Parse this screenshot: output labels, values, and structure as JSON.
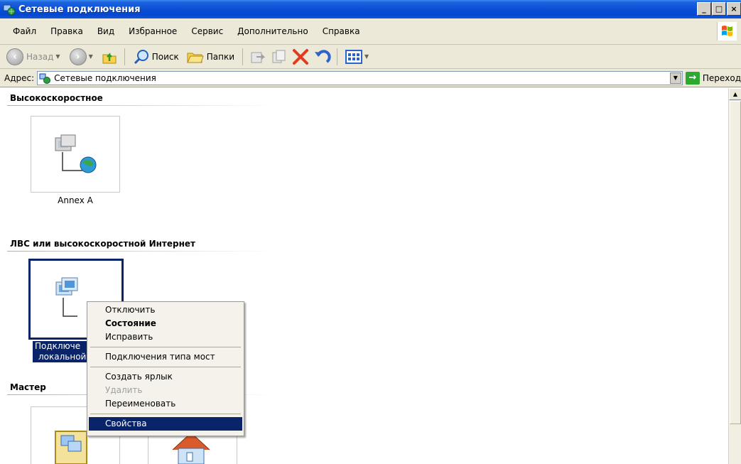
{
  "window": {
    "title": "Сетевые подключения",
    "controls": {
      "minimize": "_",
      "maximize": "□",
      "close": "×"
    }
  },
  "menu": [
    "Файл",
    "Правка",
    "Вид",
    "Избранное",
    "Сервис",
    "Дополнительно",
    "Справка"
  ],
  "toolbar": {
    "back_label": "Назад",
    "search_label": "Поиск",
    "folders_label": "Папки"
  },
  "address": {
    "label": "Адрес:",
    "value": "Сетевые подключения",
    "go_label": "Переход"
  },
  "groups": [
    {
      "header": "Высокоскоростное",
      "items": [
        {
          "label": "Annex A"
        }
      ]
    },
    {
      "header": "ЛВС или высокоскоростной Интернет",
      "items": [
        {
          "label_line1": "Подключе",
          "label_line2": "локальной"
        }
      ]
    },
    {
      "header": "Мастер",
      "items": []
    }
  ],
  "context_menu": {
    "items": [
      {
        "label": "Отключить",
        "style": "normal"
      },
      {
        "label": "Состояние",
        "style": "bold"
      },
      {
        "label": "Исправить",
        "style": "normal"
      },
      {
        "label": "Подключения типа мост",
        "style": "normal"
      },
      {
        "label": "Создать ярлык",
        "style": "normal"
      },
      {
        "label": "Удалить",
        "style": "disabled"
      },
      {
        "label": "Переименовать",
        "style": "normal"
      },
      {
        "label": "Свойства",
        "style": "highlighted"
      }
    ]
  },
  "colors": {
    "titlebar": "#0a4fd6",
    "selection": "#0a246a",
    "chrome": "#ece9d8"
  }
}
